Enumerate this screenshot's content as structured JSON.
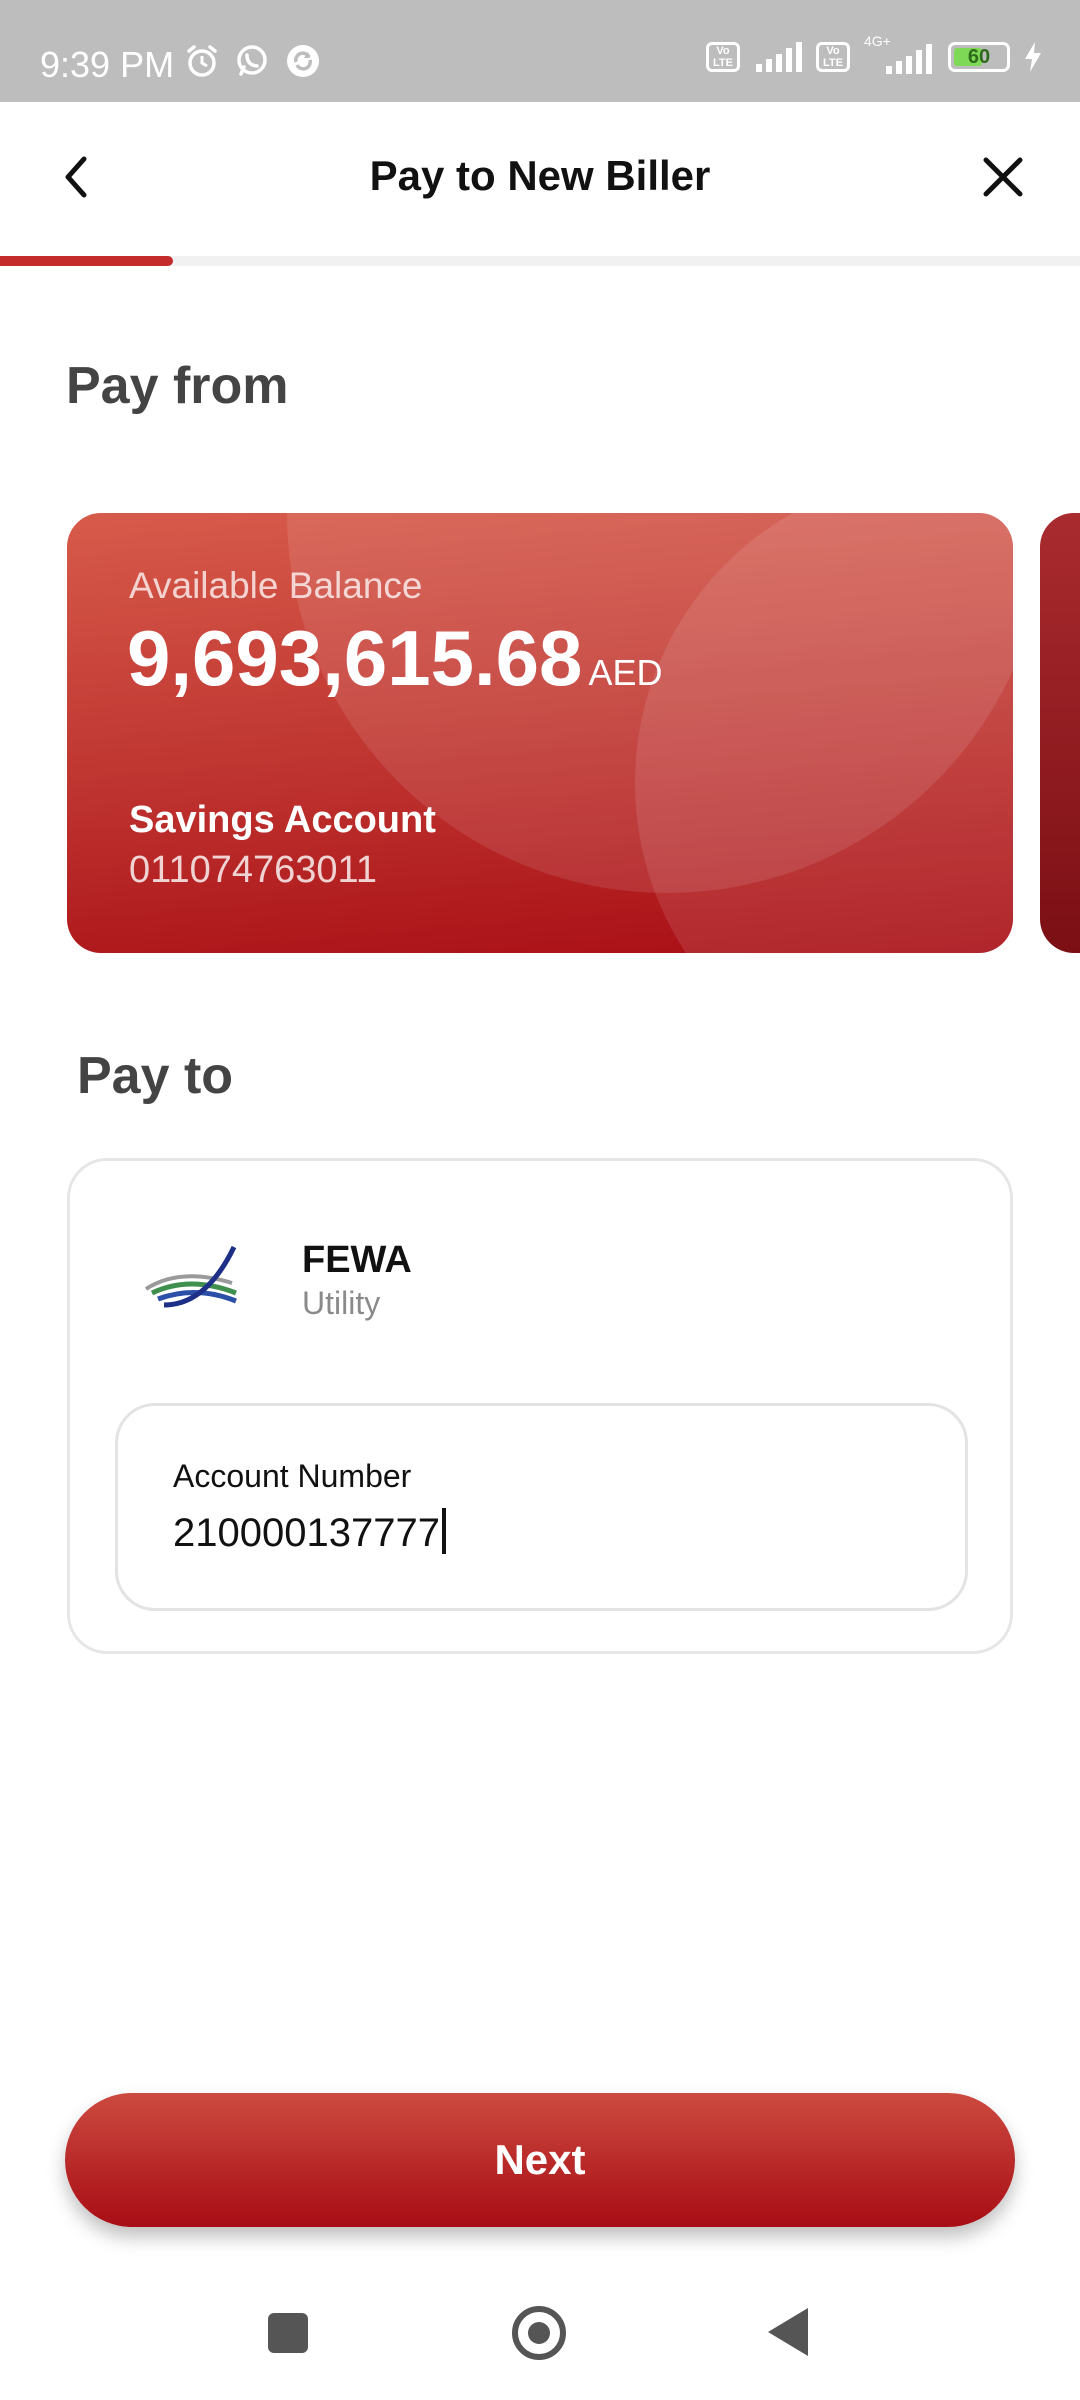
{
  "status_bar": {
    "time": "9:39 PM",
    "left_icons": [
      "alarm-icon",
      "whatsapp-icon",
      "sync-icon"
    ],
    "volte1": "Vo LTE",
    "volte2": "Vo LTE",
    "network": "4G+",
    "battery": "60",
    "battery_level": 0.6
  },
  "header": {
    "title": "Pay to New Biller",
    "back_icon": "chevron-left-icon",
    "close_icon": "close-icon",
    "progress": 0.16
  },
  "pay_from": {
    "label": "Pay from",
    "card": {
      "balance_label": "Available Balance",
      "balance": "9,693,615.68",
      "currency": "AED",
      "account_type": "Savings Account",
      "account_number": "011074763011"
    }
  },
  "pay_to": {
    "label": "Pay to",
    "biller": {
      "name": "FEWA",
      "category": "Utility"
    },
    "account_field": {
      "label": "Account Number",
      "value": "210000137777"
    }
  },
  "next_button": {
    "label": "Next"
  },
  "colors": {
    "brand": "#b3151b",
    "progress": "#c42c2c"
  }
}
